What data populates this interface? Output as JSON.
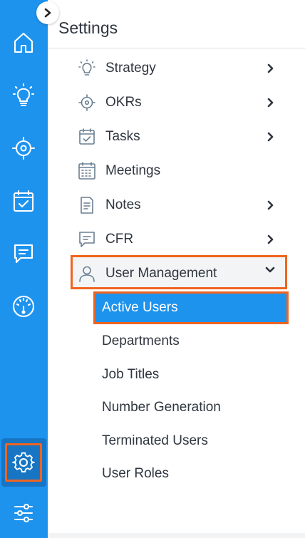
{
  "rail": {
    "icons": [
      "home-icon",
      "lightbulb-icon",
      "target-icon",
      "calendar-check-icon",
      "chat-icon",
      "speedometer-icon",
      "gear-icon",
      "sliders-icon"
    ]
  },
  "panel": {
    "title": "Settings"
  },
  "menu": {
    "strategy": "Strategy",
    "okrs": "OKRs",
    "tasks": "Tasks",
    "meetings": "Meetings",
    "notes": "Notes",
    "cfr": "CFR",
    "user_management": "User Management"
  },
  "submenu": {
    "active_users": "Active Users",
    "departments": "Departments",
    "job_titles": "Job Titles",
    "number_generation": "Number Generation",
    "terminated_users": "Terminated Users",
    "user_roles": "User Roles"
  },
  "colors": {
    "rail": "#1e93ee",
    "highlight": "#f0641e",
    "selected": "#1e93ee"
  }
}
